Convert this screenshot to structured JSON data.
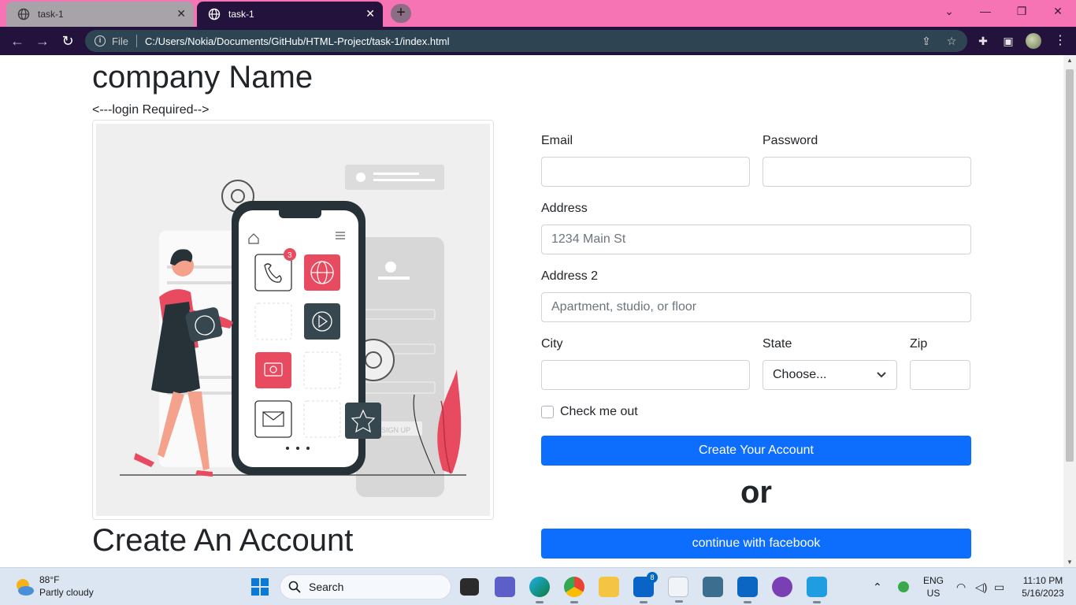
{
  "browser": {
    "tabs": [
      {
        "title": "task-1",
        "active": false
      },
      {
        "title": "task-1",
        "active": true
      }
    ],
    "new_tab": "+",
    "address": {
      "scheme_label": "File",
      "url": "C:/Users/Nokia/Documents/GitHub/HTML-Project/task-1/index.html"
    }
  },
  "page": {
    "company_name": "company Name",
    "login_note": "<---login Required-->",
    "heading": "Create An Account",
    "illustration": {
      "phone_badge": "3",
      "sign_up_label": "SIGN UP"
    },
    "form": {
      "email_label": "Email",
      "password_label": "Password",
      "address_label": "Address",
      "address_placeholder": "1234 Main St",
      "address2_label": "Address 2",
      "address2_placeholder": "Apartment, studio, or floor",
      "city_label": "City",
      "state_label": "State",
      "state_selected": "Choose...",
      "zip_label": "Zip",
      "checkbox_label": "Check me out",
      "checkbox_checked": false,
      "submit_label": "Create Your Account",
      "or_text": "or",
      "facebook_label": "continue with facebook"
    },
    "colors": {
      "primary_button": "#0d6efd",
      "tab_strip": "#f774b4",
      "toolbar": "#23123b"
    }
  },
  "taskbar": {
    "weather_temp": "88°F",
    "weather_desc": "Partly cloudy",
    "search_placeholder": "Search",
    "mail_badge": "8",
    "language": "ENG",
    "region": "US",
    "time": "11:10 PM",
    "date": "5/16/2023"
  }
}
